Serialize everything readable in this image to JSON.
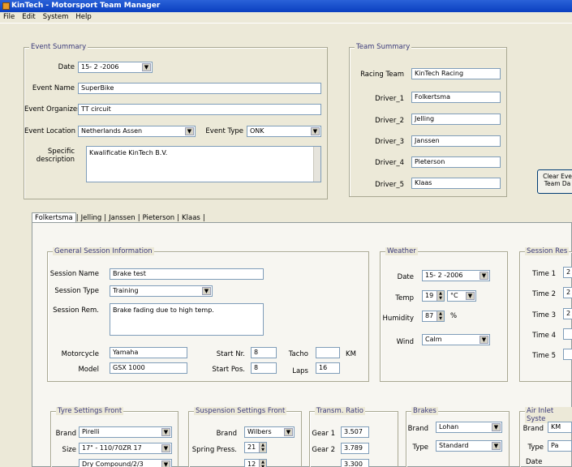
{
  "window": {
    "title": "KinTech - Motorsport Team Manager"
  },
  "menu": [
    "File",
    "Edit",
    "System",
    "Help"
  ],
  "event_summary": {
    "legend": "Event Summary",
    "date_label": "Date",
    "date_value": "15- 2 -2006",
    "name_label": "Event Name",
    "name_value": "SuperBike",
    "organizer_label": "Event Organizer",
    "organizer_value": "TT circuit",
    "location_label": "Event Location",
    "location_value": "Netherlands Assen",
    "type_label": "Event Type",
    "type_value": "ONK",
    "specific_label_1": "Specific",
    "specific_label_2": "description",
    "specific_value": "Kwalificatie KinTech B.V."
  },
  "team_summary": {
    "legend": "Team Summary",
    "racing_team_label": "Racing Team",
    "racing_team_value": "KinTech Racing",
    "drivers": [
      {
        "label": "Driver_1",
        "value": "Folkertsma"
      },
      {
        "label": "Driver_2",
        "value": "Jelling"
      },
      {
        "label": "Driver_3",
        "value": "Janssen"
      },
      {
        "label": "Driver_4",
        "value": "Pieterson"
      },
      {
        "label": "Driver_5",
        "value": "Klaas"
      }
    ]
  },
  "clear_button": {
    "line1": "Clear Eve",
    "line2": "Team Da"
  },
  "tabs": [
    "Folkertsma",
    "Jelling",
    "Janssen",
    "Pieterson",
    "Klaas"
  ],
  "general": {
    "legend": "General Session Information",
    "session_name_label": "Session Name",
    "session_name_value": "Brake test",
    "session_type_label": "Session Type",
    "session_type_value": "Training",
    "session_rem_label": "Session Rem.",
    "session_rem_value": "Brake fading due to high temp.",
    "motorcycle_label": "Motorcycle",
    "motorcycle_value": "Yamaha",
    "model_label": "Model",
    "model_value": "GSX 1000",
    "start_nr_label": "Start Nr.",
    "start_nr_value": "8",
    "start_pos_label": "Start Pos.",
    "start_pos_value": "8",
    "tacho_label": "Tacho",
    "tacho_value": "",
    "km_label": "KM",
    "laps_label": "Laps",
    "laps_value": "16"
  },
  "weather": {
    "legend": "Weather",
    "date_label": "Date",
    "date_value": "15- 2 -2006",
    "temp_label": "Temp",
    "temp_value": "19",
    "temp_unit": "°C",
    "humidity_label": "Humidity",
    "humidity_value": "87",
    "humidity_unit": "%",
    "wind_label": "Wind",
    "wind_value": "Calm"
  },
  "session_results": {
    "legend": "Session Res",
    "times": [
      {
        "label": "Time 1",
        "value": "2"
      },
      {
        "label": "Time 2",
        "value": "2"
      },
      {
        "label": "Time 3",
        "value": "2"
      },
      {
        "label": "Time 4",
        "value": ""
      },
      {
        "label": "Time 5",
        "value": ""
      }
    ]
  },
  "tyre": {
    "legend": "Tyre Settings Front",
    "brand_label": "Brand",
    "brand_value": "Pirelli",
    "size_label": "Size",
    "size_value": "17\" - 110/70ZR 17",
    "extra_value": "Dry Compound/2/3"
  },
  "suspension": {
    "legend": "Suspension Settings Front",
    "brand_label": "Brand",
    "brand_value": "Wilbers",
    "spring_label": "Spring Press.",
    "spring_value": "21",
    "extra_value": "12"
  },
  "transm": {
    "legend": "Transm. Ratio",
    "gear1_label": "Gear 1",
    "gear1_value": "3.507",
    "gear2_label": "Gear 2",
    "gear2_value": "3.789",
    "gear3_value": "3.300"
  },
  "brakes": {
    "legend": "Brakes",
    "brand_label": "Brand",
    "brand_value": "Lohan",
    "type_label": "Type",
    "type_value": "Standard"
  },
  "air_inlet": {
    "legend": "Air Inlet Syste",
    "brand_label": "Brand",
    "brand_value": "KM",
    "type_label": "Type",
    "type_value": "Pa",
    "date_label": "Date"
  }
}
